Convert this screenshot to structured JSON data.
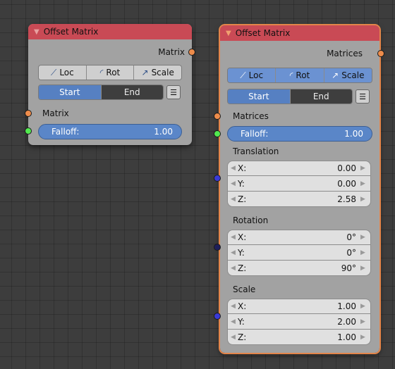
{
  "node1": {
    "title": "Offset Matrix",
    "output": "Matrix",
    "mode_tabs": [
      "Loc",
      "Rot",
      "Scale"
    ],
    "start_label": "Start",
    "end_label": "End",
    "input": "Matrix",
    "falloff_label": "Falloff:",
    "falloff_value": "1.00"
  },
  "node2": {
    "title": "Offset Matrix",
    "output": "Matrices",
    "mode_tabs": [
      "Loc",
      "Rot",
      "Scale"
    ],
    "start_label": "Start",
    "end_label": "End",
    "input": "Matrices",
    "falloff_label": "Falloff:",
    "falloff_value": "1.00",
    "translation": {
      "label": "Translation",
      "x_label": "X:",
      "x": "0.00",
      "y_label": "Y:",
      "y": "0.00",
      "z_label": "Z:",
      "z": "2.58"
    },
    "rotation": {
      "label": "Rotation",
      "x_label": "X:",
      "x": "0°",
      "y_label": "Y:",
      "y": "0°",
      "z_label": "Z:",
      "z": "90°"
    },
    "scale": {
      "label": "Scale",
      "x_label": "X:",
      "x": "1.00",
      "y_label": "Y:",
      "y": "2.00",
      "z_label": "Z:",
      "z": "1.00"
    }
  },
  "colors": {
    "header": "#c94a55",
    "node_body": "#a2a2a2",
    "selected_outline": "#e3854a",
    "socket_matrix": "#ee8c4b",
    "socket_float": "#52e94f",
    "socket_vector": "#3a3ad6",
    "active_button": "#5680c2"
  },
  "icons": {
    "loc": "loc-icon",
    "rot": "rot-icon",
    "scale": "scale-icon",
    "list": "list-icon",
    "collapse": "collapse-triangle-icon"
  }
}
